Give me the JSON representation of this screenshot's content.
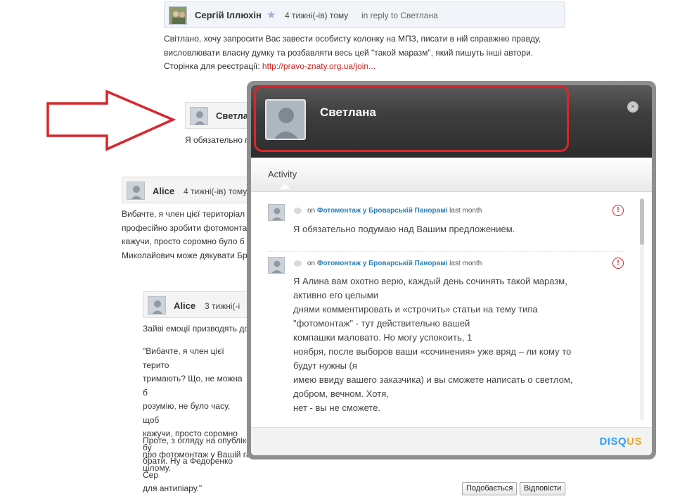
{
  "comment1": {
    "author": "Сергій Іллюхін",
    "time": "4 тижні(-ів) тому",
    "reply_to": "in reply to Светлана",
    "text_lines": [
      "Світлано, хочу запросити Вас завести особисту колонку на МПЗ, писати в ній справжню правду,",
      "висловлювати власну думку та розбавляти весь цей \"такой маразм\", який пишуть інші автори."
    ],
    "signup_label": "Сторінка для реєстрації: ",
    "signup_link": "http://pravo-znaty.org.ua/join..."
  },
  "comment2": {
    "author": "Светлана",
    "text": "Я обязательно п"
  },
  "comment3": {
    "author": "Alice",
    "time": "4 тижні(-ів) тому",
    "text_lines": [
      " Вибачте, я член цієї територіал",
      "професійно зробити фотомонтаж",
      "кажучи, просто соромно було б з",
      "Миколайович може дякувати Бра"
    ]
  },
  "comment4": {
    "author": "Alice",
    "time": "3 тижні(-і",
    "text1": "Зайві емоції призводять до",
    "quote_lines": [
      "\"Вибачте, я член цієї терито",
      "тримають? Що, не можна б",
      "розумію, не було часу, щоб",
      "кажучи, просто соромно бу",
      "брати. Ну а Федоренко Сер",
      "для антипіару.\""
    ],
    "text2_lines": [
      "Проте, з огляду на опублікс",
      "про фотомонтаж  у Вашій газеті, маю вибачитися перед Бражко в принципі за весь свій коментар у",
      "цілому."
    ],
    "like_button": "Подобається",
    "reply_button": "Відповісти"
  },
  "popup": {
    "user_name": "Светлана",
    "close_glyph": "×",
    "tab": "Activity",
    "items": [
      {
        "on": "on",
        "thread": "Фотомонтаж у Броварській Панорамі",
        "when": "last month",
        "text_lines": [
          "Я обязательно подумаю над Вашим предложением."
        ]
      },
      {
        "on": "on",
        "thread": "Фотомонтаж у Броварській Панорамі",
        "when": "last month",
        "text_lines": [
          "Я Алина вам охотно верю, каждый день  сочинять такой маразм,",
          "активно его целыми",
          "днями  комментировать и «строчить» статьи на тему типа",
          " \"фотомонтаж\"   - тут действительно  вашей",
          "компашки маловато.  Но могу успокоить,  1",
          "ноября, после выборов ваши «сочинения» уже вряд – ли кому то",
          "будут нужны (я",
          "имею ввиду вашего заказчика) и вы сможете написать о светлом,",
          "добром, вечном. Хотя,",
          "нет -  вы не сможете."
        ]
      }
    ],
    "brand_a": "DISQ",
    "brand_b": "US"
  },
  "annotation_color": "#d9262c"
}
